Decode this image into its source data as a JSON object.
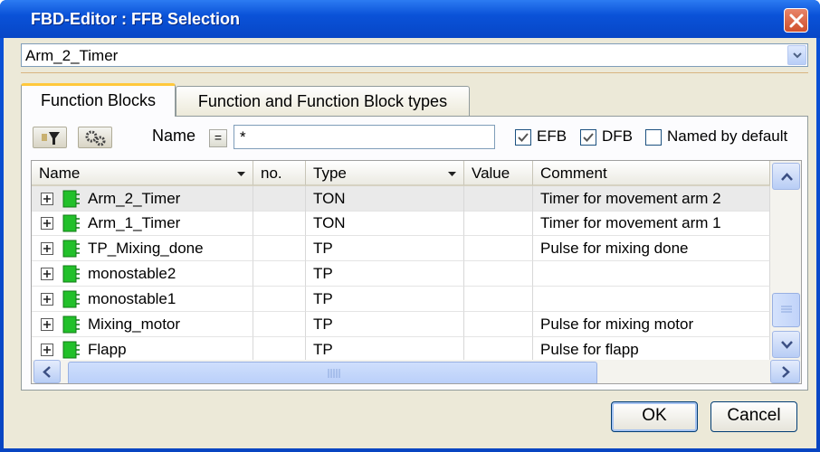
{
  "window": {
    "title": "FBD-Editor : FFB Selection"
  },
  "instance_combo": {
    "value": "Arm_2_Timer"
  },
  "tabs": [
    {
      "label": "Function Blocks",
      "active": true
    },
    {
      "label": "Function and Function Block types",
      "active": false
    }
  ],
  "filter": {
    "name_label": "Name",
    "eq_label": "=",
    "name_value": "*",
    "checkboxes": [
      {
        "label": "EFB",
        "checked": true
      },
      {
        "label": "DFB",
        "checked": true
      },
      {
        "label": "Named by default",
        "checked": false
      }
    ]
  },
  "table": {
    "columns": [
      "Name",
      "no.",
      "Type",
      "Value",
      "Comment"
    ],
    "rows": [
      {
        "name": "Arm_2_Timer",
        "no": "",
        "type": "TON",
        "value": "",
        "comment": "Timer for movement arm 2",
        "selected": true
      },
      {
        "name": "Arm_1_Timer",
        "no": "",
        "type": "TON",
        "value": "",
        "comment": "Timer for movement arm 1",
        "selected": false
      },
      {
        "name": "TP_Mixing_done",
        "no": "",
        "type": "TP",
        "value": "",
        "comment": "Pulse for mixing done",
        "selected": false
      },
      {
        "name": "monostable2",
        "no": "",
        "type": "TP",
        "value": "",
        "comment": "",
        "selected": false
      },
      {
        "name": "monostable1",
        "no": "",
        "type": "TP",
        "value": "",
        "comment": "",
        "selected": false
      },
      {
        "name": "Mixing_motor",
        "no": "",
        "type": "TP",
        "value": "",
        "comment": "Pulse for mixing motor",
        "selected": false
      },
      {
        "name": "Flapp",
        "no": "",
        "type": "TP",
        "value": "",
        "comment": "Pulse for flapp",
        "selected": false
      }
    ]
  },
  "buttons": {
    "ok": "OK",
    "cancel": "Cancel"
  },
  "colors": {
    "titlebar": "#0a52d8",
    "client": "#ece9d8",
    "fb_icon": "#22c02a",
    "tab_highlight": "#ffc83c"
  }
}
